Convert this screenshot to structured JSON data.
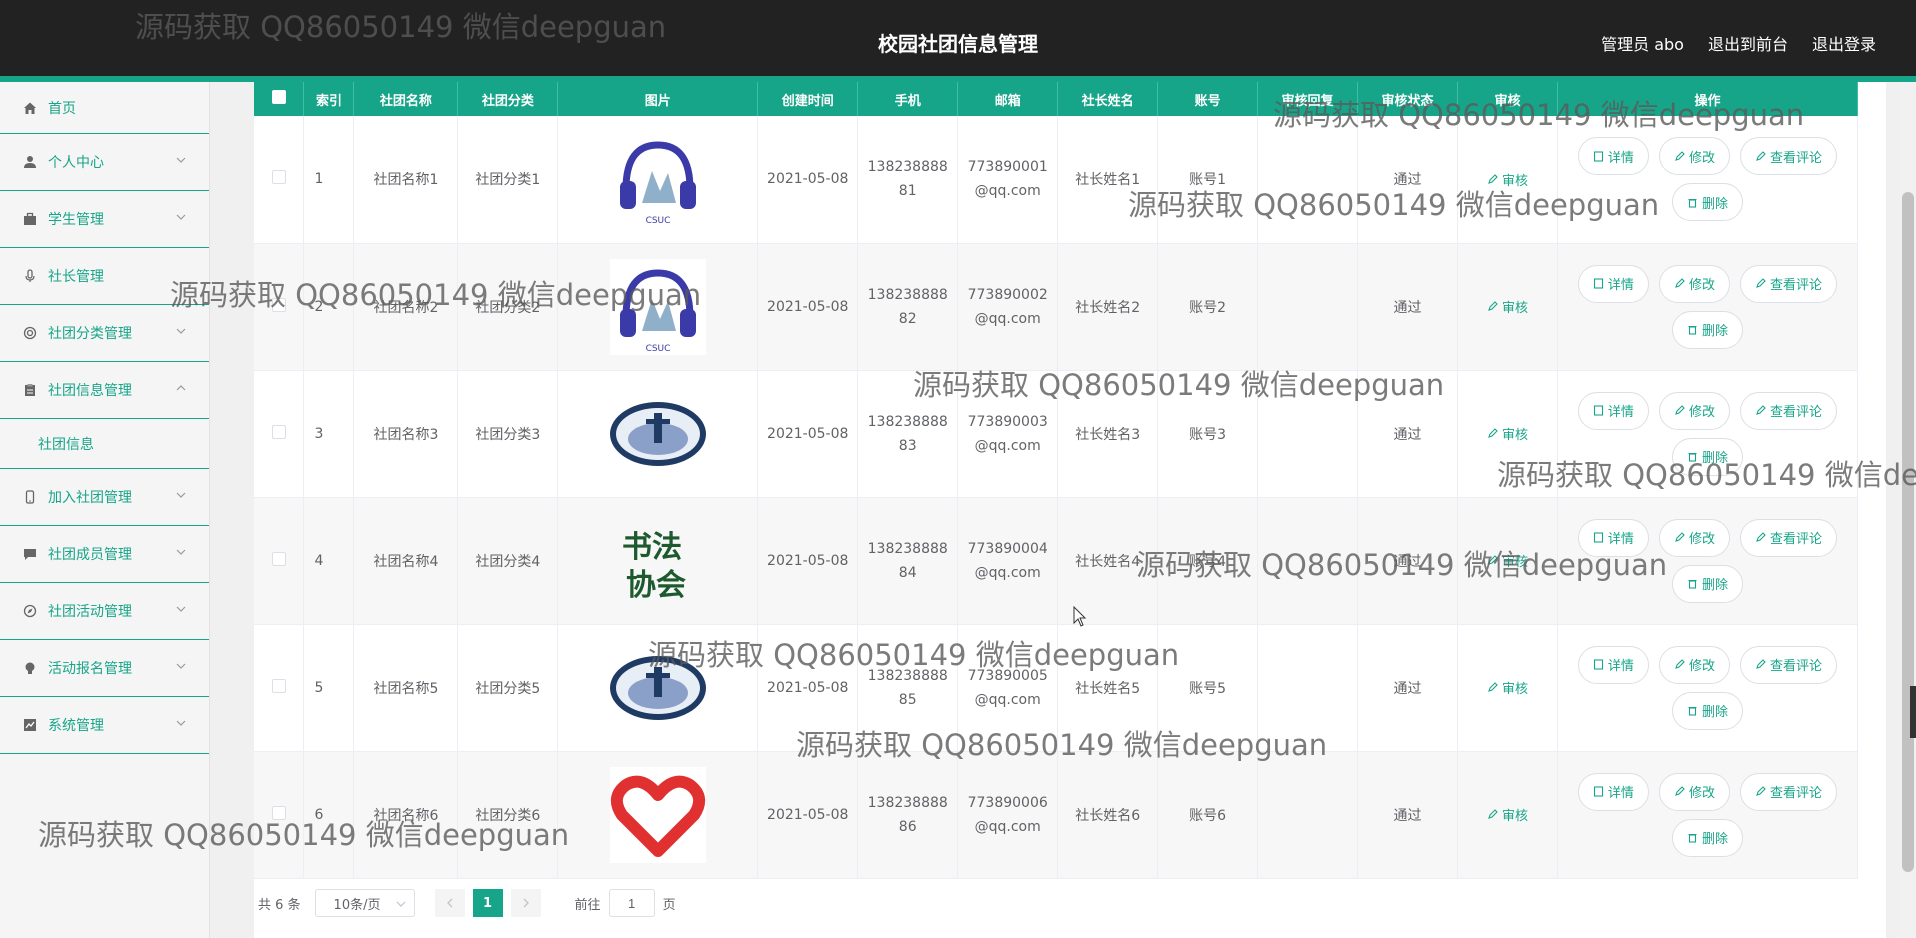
{
  "header": {
    "title": "校园社团信息管理",
    "links": [
      "管理员 abo",
      "退出到前台",
      "退出登录"
    ]
  },
  "sidebar": {
    "items": [
      {
        "label": "首页",
        "icon": "home-icon"
      },
      {
        "label": "个人中心",
        "icon": "user-icon"
      },
      {
        "label": "学生管理",
        "icon": "briefcase-icon"
      },
      {
        "label": "社长管理",
        "icon": "mic-icon"
      },
      {
        "label": "社团分类管理",
        "icon": "target-icon"
      },
      {
        "label": "社团信息管理",
        "icon": "clipboard-icon"
      },
      {
        "label": "加入社团管理",
        "icon": "phone-icon"
      },
      {
        "label": "社团成员管理",
        "icon": "chat-icon"
      },
      {
        "label": "社团活动管理",
        "icon": "compass-icon"
      },
      {
        "label": "活动报名管理",
        "icon": "bulb-icon"
      },
      {
        "label": "系统管理",
        "icon": "chart-icon"
      }
    ],
    "sub_item": "社团信息"
  },
  "table": {
    "columns": [
      "",
      "索引",
      "社团名称",
      "社团分类",
      "图片",
      "创建时间",
      "手机",
      "邮箱",
      "社长姓名",
      "账号",
      "审核回复",
      "审核状态",
      "审核",
      "操作"
    ],
    "rows": [
      {
        "index": "1",
        "name": "社团名称1",
        "category": "社团分类1",
        "created": "2021-05-08",
        "phone1": "138238888",
        "phone2": "81",
        "email1": "773890001",
        "email2": "@qq.com",
        "leader": "社长姓名1",
        "account": "账号1",
        "reply": "",
        "status": "通过"
      },
      {
        "index": "2",
        "name": "社团名称2",
        "category": "社团分类2",
        "created": "2021-05-08",
        "phone1": "138238888",
        "phone2": "82",
        "email1": "773890002",
        "email2": "@qq.com",
        "leader": "社长姓名2",
        "account": "账号2",
        "reply": "",
        "status": "通过"
      },
      {
        "index": "3",
        "name": "社团名称3",
        "category": "社团分类3",
        "created": "2021-05-08",
        "phone1": "138238888",
        "phone2": "83",
        "email1": "773890003",
        "email2": "@qq.com",
        "leader": "社长姓名3",
        "account": "账号3",
        "reply": "",
        "status": "通过"
      },
      {
        "index": "4",
        "name": "社团名称4",
        "category": "社团分类4",
        "created": "2021-05-08",
        "phone1": "138238888",
        "phone2": "84",
        "email1": "773890004",
        "email2": "@qq.com",
        "leader": "社长姓名4",
        "account": "账号4",
        "reply": "",
        "status": "通过"
      },
      {
        "index": "5",
        "name": "社团名称5",
        "category": "社团分类5",
        "created": "2021-05-08",
        "phone1": "138238888",
        "phone2": "85",
        "email1": "773890005",
        "email2": "@qq.com",
        "leader": "社长姓名5",
        "account": "账号5",
        "reply": "",
        "status": "通过"
      },
      {
        "index": "6",
        "name": "社团名称6",
        "category": "社团分类6",
        "created": "2021-05-08",
        "phone1": "138238888",
        "phone2": "86",
        "email1": "773890006",
        "email2": "@qq.com",
        "leader": "社长姓名6",
        "account": "账号6",
        "reply": "",
        "status": "通过"
      }
    ],
    "audit_label": "审核",
    "actions": {
      "detail": "详情",
      "edit": "修改",
      "comments": "查看评论",
      "delete": "删除"
    }
  },
  "pagination": {
    "total": "共 6 条",
    "page_size": "10条/页",
    "current": "1",
    "goto_prefix": "前往",
    "goto_value": "1",
    "goto_suffix": "页"
  },
  "watermark": "源码获取 QQ86050149 微信deepguan",
  "colors": {
    "accent": "#17a589",
    "topbar": "#222222"
  }
}
